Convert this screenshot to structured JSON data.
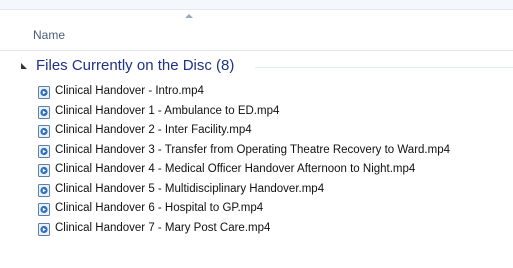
{
  "column_header": {
    "name_label": "Name"
  },
  "group": {
    "title": "Files Currently on the Disc (8)"
  },
  "files": [
    {
      "name": "Clinical Handover - Intro.mp4",
      "icon": "video-file-icon"
    },
    {
      "name": "Clinical Handover 1 - Ambulance to ED.mp4",
      "icon": "video-file-icon"
    },
    {
      "name": "Clinical Handover 2 - Inter Facility.mp4",
      "icon": "video-file-icon"
    },
    {
      "name": "Clinical Handover 3 - Transfer from Operating Theatre Recovery to Ward.mp4",
      "icon": "video-file-icon"
    },
    {
      "name": "Clinical Handover 4 - Medical Officer Handover Afternoon to Night.mp4",
      "icon": "video-file-icon"
    },
    {
      "name": "Clinical Handover 5 - Multidisciplinary Handover.mp4",
      "icon": "video-file-icon"
    },
    {
      "name": "Clinical Handover 6 - Hospital to GP.mp4",
      "icon": "video-file-icon"
    },
    {
      "name": "Clinical Handover 7 - Mary Post Care.mp4",
      "icon": "video-file-icon"
    }
  ],
  "colors": {
    "group_title": "#1e3287",
    "header_text": "#4c607a",
    "file_text": "#111111"
  }
}
